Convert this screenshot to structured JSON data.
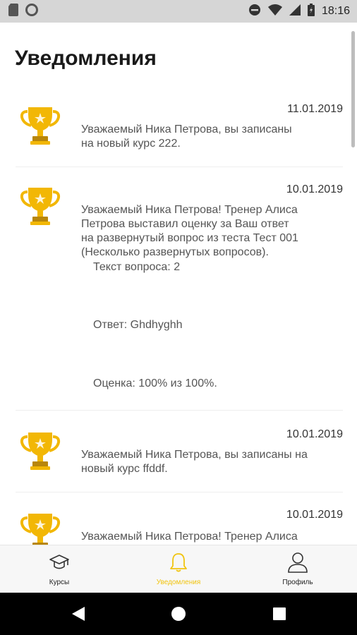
{
  "status_bar": {
    "time": "18:16",
    "icons": [
      "sd-card-icon",
      "circle-icon",
      "dnd-icon",
      "wifi-icon",
      "signal-icon",
      "battery-icon"
    ]
  },
  "page": {
    "title": "Уведомления"
  },
  "notifications": [
    {
      "date": "11.01.2019",
      "icon": "trophy-icon",
      "text_lines": [
        "Уважаемый Ника Петрова, вы записаны",
        "на новый курс 222."
      ]
    },
    {
      "date": "10.01.2019",
      "icon": "trophy-icon",
      "text_lines": [
        "Уважаемый Ника Петрова! Тренер Алиса",
        "Петрова выставил оценку за Ваш ответ",
        "на развернутый вопрос из теста Тест 001",
        "(Несколько развернутых вопросов)."
      ],
      "question": "Текст вопроса: 2",
      "answer": "Ответ: Ghdhyghh",
      "grade": "Оценка: 100% из 100%."
    },
    {
      "date": "10.01.2019",
      "icon": "trophy-icon",
      "text_lines": [
        "Уважаемый Ника Петрова, вы записаны на",
        "новый курс ffddf."
      ]
    },
    {
      "date": "10.01.2019",
      "icon": "trophy-icon",
      "text_lines": [
        "Уважаемый Ника Петрова! Тренер Алиса"
      ]
    }
  ],
  "bottom_nav": {
    "items": [
      {
        "label": "Курсы",
        "icon": "graduation-cap-icon",
        "active": false
      },
      {
        "label": "Уведомления",
        "icon": "bell-icon",
        "active": true
      },
      {
        "label": "Профиль",
        "icon": "user-icon",
        "active": false
      }
    ]
  },
  "colors": {
    "accent": "#f1c40f",
    "trophy_gold": "#f2b705",
    "trophy_dark": "#b8860b",
    "status_bar_bg": "#d6d6d6"
  }
}
